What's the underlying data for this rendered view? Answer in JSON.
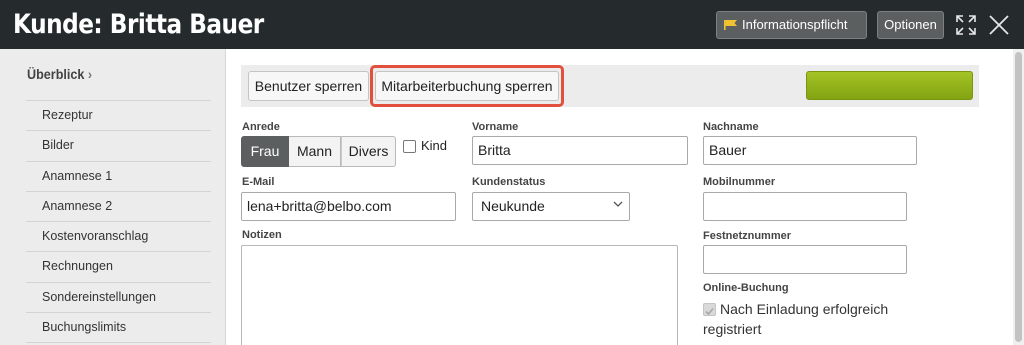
{
  "header": {
    "title": "Kunde: Britta Bauer",
    "info_button": "Informationspflicht",
    "options_button": "Optionen",
    "flag_color": "#f2c230"
  },
  "sidebar": {
    "heading": "Überblick",
    "items": [
      {
        "label": "Rezeptur"
      },
      {
        "label": "Bilder"
      },
      {
        "label": "Anamnese 1"
      },
      {
        "label": "Anamnese 2"
      },
      {
        "label": "Kostenvoranschlag"
      },
      {
        "label": "Rechnungen"
      },
      {
        "label": "Sondereinstellungen"
      },
      {
        "label": "Buchungslimits"
      }
    ]
  },
  "toolbar": {
    "lock_user": "Benutzer sperren",
    "lock_staff_booking": "Mitarbeiterbuchung sperren",
    "accent_color": "#95b41b",
    "highlight_color": "#e24f3c"
  },
  "form": {
    "salutation": {
      "label": "Anrede",
      "options": [
        "Frau",
        "Mann",
        "Divers"
      ],
      "selected": "Frau"
    },
    "child": {
      "label": "Kind",
      "checked": false
    },
    "first_name": {
      "label": "Vorname",
      "value": "Britta"
    },
    "last_name": {
      "label": "Nachname",
      "value": "Bauer"
    },
    "email": {
      "label": "E-Mail",
      "value": "lena+britta@belbo.com"
    },
    "customer_status": {
      "label": "Kundenstatus",
      "value": "Neukunde"
    },
    "mobile": {
      "label": "Mobilnummer",
      "value": ""
    },
    "notes": {
      "label": "Notizen",
      "value": ""
    },
    "landline": {
      "label": "Festnetznummer",
      "value": ""
    },
    "online_booking": {
      "label": "Online-Buchung",
      "status_text": "Nach Einladung erfolgreich registriert",
      "checked": true
    }
  }
}
